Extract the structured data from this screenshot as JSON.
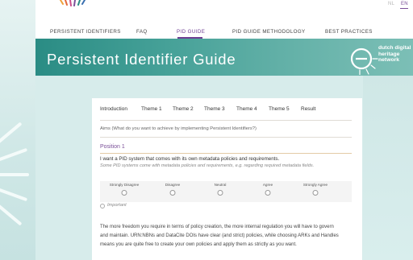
{
  "header": {
    "languages": [
      {
        "label": "NL",
        "active": false
      },
      {
        "label": "EN",
        "active": true
      }
    ],
    "nav": [
      {
        "label": "PERSISTENT IDENTIFIERS",
        "active": false
      },
      {
        "label": "FAQ",
        "active": false
      },
      {
        "label": "PID GUIDE",
        "active": true
      },
      {
        "label": "PID GUIDE METHODOLOGY",
        "active": false
      },
      {
        "label": "BEST PRACTICES",
        "active": false
      }
    ]
  },
  "hero": {
    "title": "Persistent Identifier Guide",
    "logo_lines": [
      "dutch digital",
      "heritage",
      "network"
    ]
  },
  "tabs": [
    {
      "label": "Introduction"
    },
    {
      "label": "Theme 1"
    },
    {
      "label": "Theme 2"
    },
    {
      "label": "Theme 3"
    },
    {
      "label": "Theme 4"
    },
    {
      "label": "Theme 5"
    },
    {
      "label": "Result"
    }
  ],
  "question": "Aims (What do you want to achieve by implementing Persistent Identifiers?)",
  "position": {
    "title": "Position 1",
    "statement": "I want a PID system that comes with its own metadata policies and requirements.",
    "subtext": "Some PID systems come with metadata policies and requirements, e.g. regarding required metadata fields.",
    "scale": [
      "Strongly Disagree",
      "Disagree",
      "Neutral",
      "Agree",
      "Strongly Agree"
    ],
    "important_label": "Important"
  },
  "paragraph": "The more freedom you require in terms of policy creation, the more internal regulation you will have to govern and maintain. URN:NBNs and DataCite DOIs have clear (and strict) policies, while choosing ARKs and Handles means you are quite free to create your own policies and apply them as strictly as you want.",
  "colors": {
    "accent_purple": "#6e3f93",
    "hero_teal": "#2a8c84",
    "position_line": "#e4cba6"
  }
}
